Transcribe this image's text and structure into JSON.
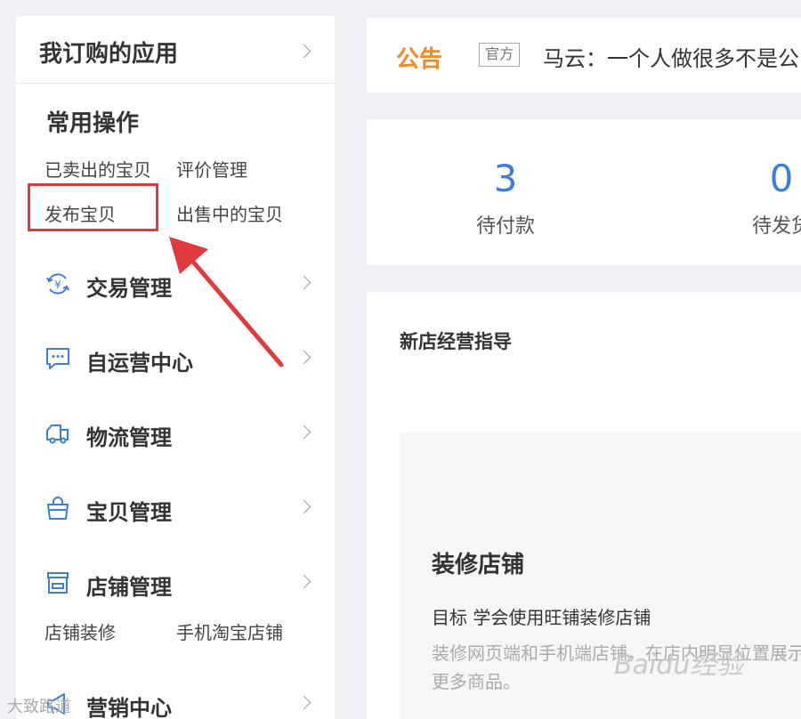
{
  "sidebar": {
    "header_title": "我订购的应用",
    "common_ops_title": "常用操作",
    "quick_links": {
      "sold_items": "已卖出的宝贝",
      "review_mgmt": "评价管理",
      "publish_item": "发布宝贝",
      "on_sale_items": "出售中的宝贝"
    },
    "menu": [
      {
        "label": "交易管理",
        "icon": "yen-cycle-icon"
      },
      {
        "label": "自运营中心",
        "icon": "chat-bubble-icon"
      },
      {
        "label": "物流管理",
        "icon": "truck-icon"
      },
      {
        "label": "宝贝管理",
        "icon": "bag-icon"
      },
      {
        "label": "店铺管理",
        "icon": "store-icon"
      },
      {
        "label": "营销中心",
        "icon": "megaphone-icon"
      }
    ],
    "shop_sub_links": {
      "decorate": "店铺装修",
      "mobile_shop": "手机淘宝店铺"
    }
  },
  "notice": {
    "label": "公告",
    "tag": "官方",
    "text": "马云：一个人做很多不是公"
  },
  "stats": [
    {
      "value": "3",
      "label": "待付款"
    },
    {
      "value": "0",
      "label": "待发货"
    }
  ],
  "guide": {
    "title": "新店经营指导",
    "card_title": "装修店铺",
    "goal": "目标 学会使用旺铺装修店铺",
    "desc": "装修网页端和手机端店铺，在店内明显位置展示更多商品。"
  },
  "watermark": "Baidu经验",
  "corner_mark": "大致路道",
  "colors": {
    "accent_blue": "#3b7ed6",
    "notice_orange": "#f08a24",
    "highlight_red": "#e0393e"
  }
}
